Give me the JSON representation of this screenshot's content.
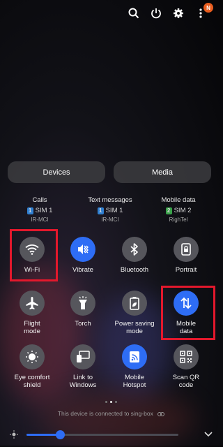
{
  "top": {
    "notification_badge": "N"
  },
  "pills": {
    "devices": "Devices",
    "media": "Media"
  },
  "sims": [
    {
      "title": "Calls",
      "sim_num": "1",
      "sim_label": "SIM 1",
      "carrier": "IR-MCI",
      "color": "#2f7fd1"
    },
    {
      "title": "Text messages",
      "sim_num": "1",
      "sim_label": "SIM 1",
      "carrier": "IR-MCI",
      "color": "#2f7fd1"
    },
    {
      "title": "Mobile data",
      "sim_num": "2",
      "sim_label": "SIM 2",
      "carrier": "RighTel",
      "color": "#3aa34a"
    }
  ],
  "tiles": {
    "wifi": "Wi-Fi",
    "vibrate": "Vibrate",
    "bluetooth": "Bluetooth",
    "portrait": "Portrait",
    "flight": "Flight\nmode",
    "torch": "Torch",
    "power_saving": "Power saving\nmode",
    "mobile_data": "Mobile\ndata",
    "eye_comfort": "Eye comfort\nshield",
    "link_windows": "Link to\nWindows",
    "hotspot": "Mobile\nHotspot",
    "scan_qr": "Scan QR\ncode"
  },
  "status": {
    "connected": "This device is connected to sing-box"
  },
  "brightness": {
    "level": 0.22
  },
  "colors": {
    "accent": "#2e6df5",
    "highlight": "#e3182c"
  }
}
